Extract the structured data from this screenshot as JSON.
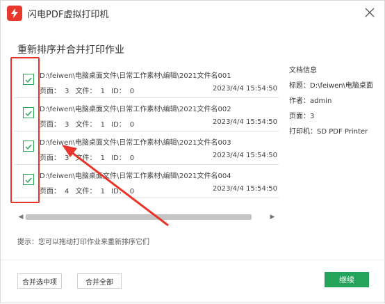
{
  "window": {
    "title": "闪电PDF虚拟打印机"
  },
  "section_title": "重新排序并合并打印作业",
  "jobs": [
    {
      "path": "D:\\feiwen\\电脑桌面文件\\日常工作素材\\编辑\\2021文件名001",
      "pages_label": "页面：",
      "pages": "3",
      "files_label": "文件：",
      "files": "1",
      "id_label": "ID：",
      "id": "0",
      "date": "2023/4/4 15:54:50",
      "checked": true
    },
    {
      "path": "D:\\feiwen\\电脑桌面文件\\日常工作素材\\编辑\\2021文件名002",
      "pages_label": "页面：",
      "pages": "3",
      "files_label": "文件：",
      "files": "1",
      "id_label": "ID：",
      "id": "0",
      "date": "2023/4/4 15:54:50",
      "checked": true
    },
    {
      "path": "D:\\feiwen\\电脑桌面文件\\日常工作素材\\编辑\\2021文件名003",
      "pages_label": "页面：",
      "pages": "3",
      "files_label": "文件：",
      "files": "1",
      "id_label": "ID：",
      "id": "0",
      "date": "2023/4/4 15:54:50",
      "checked": true
    },
    {
      "path": "D:\\feiwen\\电脑桌面文件\\日常工作素材\\编辑\\2021文件名004",
      "pages_label": "页面：",
      "pages": "4",
      "files_label": "文件：",
      "files": "1",
      "id_label": "ID：",
      "id": "0",
      "date": "2023/4/4 15:54:50",
      "checked": true
    }
  ],
  "info": {
    "heading": "文档信息",
    "title_label": "标题：",
    "title_value": "D:\\feiwen\\电脑桌面",
    "author_label": "作者：",
    "author_value": "admin",
    "pages_label": "页面：",
    "pages_value": "3",
    "printer_label": "打印机：",
    "printer_value": "SD PDF Printer"
  },
  "tip": "提示：您可以拖动打印作业来重新排序它们",
  "buttons": {
    "merge_selected": "合并选中项",
    "merge_all": "合并全部",
    "continue": "继续"
  },
  "colors": {
    "accent_green": "#24a35a",
    "annotation_red": "#e8352b",
    "logo_red": "#e83a2c"
  }
}
